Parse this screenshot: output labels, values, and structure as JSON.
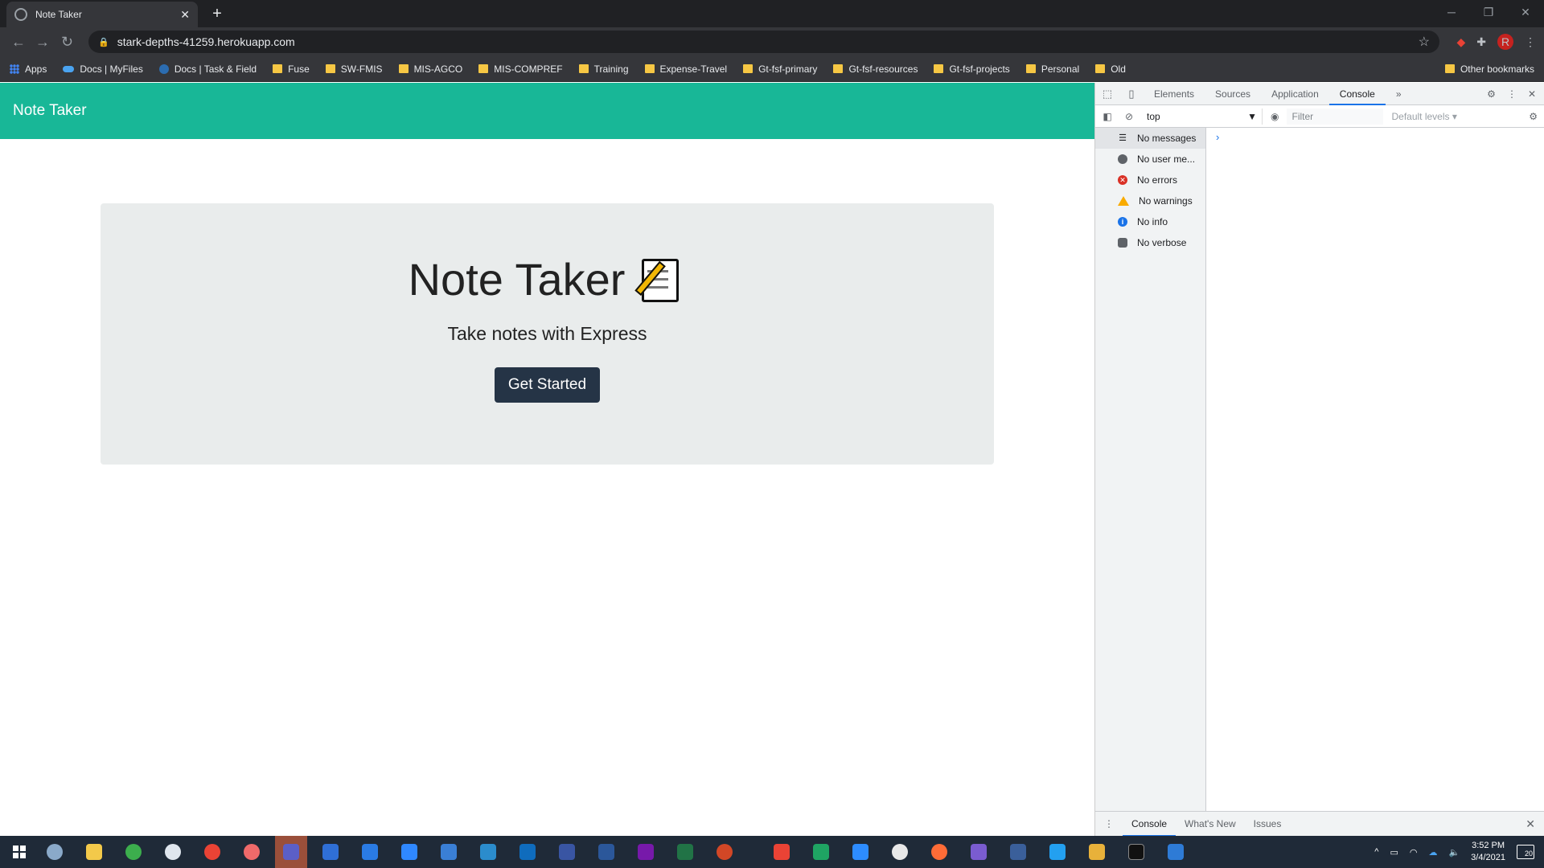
{
  "browser": {
    "tab_title": "Note Taker",
    "new_tab": "+",
    "url": "stark-depths-41259.herokuapp.com",
    "avatar_letter": "R",
    "bookmarks": [
      "Apps",
      "Docs | MyFiles",
      "Docs | Task & Field",
      "Fuse",
      "SW-FMIS",
      "MIS-AGCO",
      "MIS-COMPREF",
      "Training",
      "Expense-Travel",
      "Gt-fsf-primary",
      "Gt-fsf-resources",
      "Gt-fsf-projects",
      "Personal",
      "Old"
    ],
    "other_bookmarks": "Other bookmarks"
  },
  "page": {
    "navbar_brand": "Note Taker",
    "heading": "Note Taker",
    "heading_emoji": "memo-icon",
    "lead": "Take notes with Express",
    "cta": "Get Started",
    "colors": {
      "navbar": "#18b797",
      "button": "#253446",
      "jumbotron": "#e9ecec"
    }
  },
  "devtools": {
    "tabs": [
      "Elements",
      "Sources",
      "Application",
      "Console"
    ],
    "active_tab": "Console",
    "more": "»",
    "context": "top",
    "filter_placeholder": "Filter",
    "levels": "Default levels ▾",
    "sidebar": [
      "No messages",
      "No user me...",
      "No errors",
      "No warnings",
      "No info",
      "No verbose"
    ],
    "prompt": "›",
    "drawer_tabs": [
      "Console",
      "What's New",
      "Issues"
    ]
  },
  "taskbar": {
    "time": "3:52 PM",
    "date": "3/4/2021",
    "notifications": "20"
  }
}
